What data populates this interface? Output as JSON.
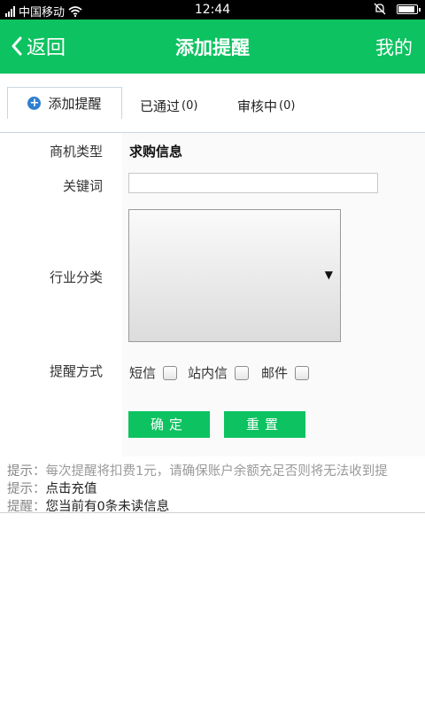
{
  "status": {
    "carrier": "中国移动",
    "time": "12:44"
  },
  "header": {
    "back_label": "返回",
    "title": "添加提醒",
    "right_label": "我的"
  },
  "tabs": [
    {
      "label": "添加提醒",
      "count": ""
    },
    {
      "label": "已通过",
      "count": "(0)"
    },
    {
      "label": "审核中",
      "count": "(0)"
    }
  ],
  "form": {
    "type_label": "商机类型",
    "type_value": "求购信息",
    "keyword_label": "关键词",
    "keyword_value": "",
    "industry_label": "行业分类",
    "method_label": "提醒方式",
    "methods": [
      "短信",
      "站内信",
      "邮件"
    ],
    "confirm_label": "确定",
    "reset_label": "重置"
  },
  "tips": [
    {
      "key": "提示：",
      "text": "每次提醒将扣费1元，请确保账户余额充足否则将无法收到提"
    },
    {
      "key": "提示：",
      "text": "点击充值"
    },
    {
      "key": "提醒：",
      "text": "您当前有0条未读信息"
    }
  ],
  "colors": {
    "accent": "#0dc260",
    "tab_icon": "#2f7fd0"
  }
}
